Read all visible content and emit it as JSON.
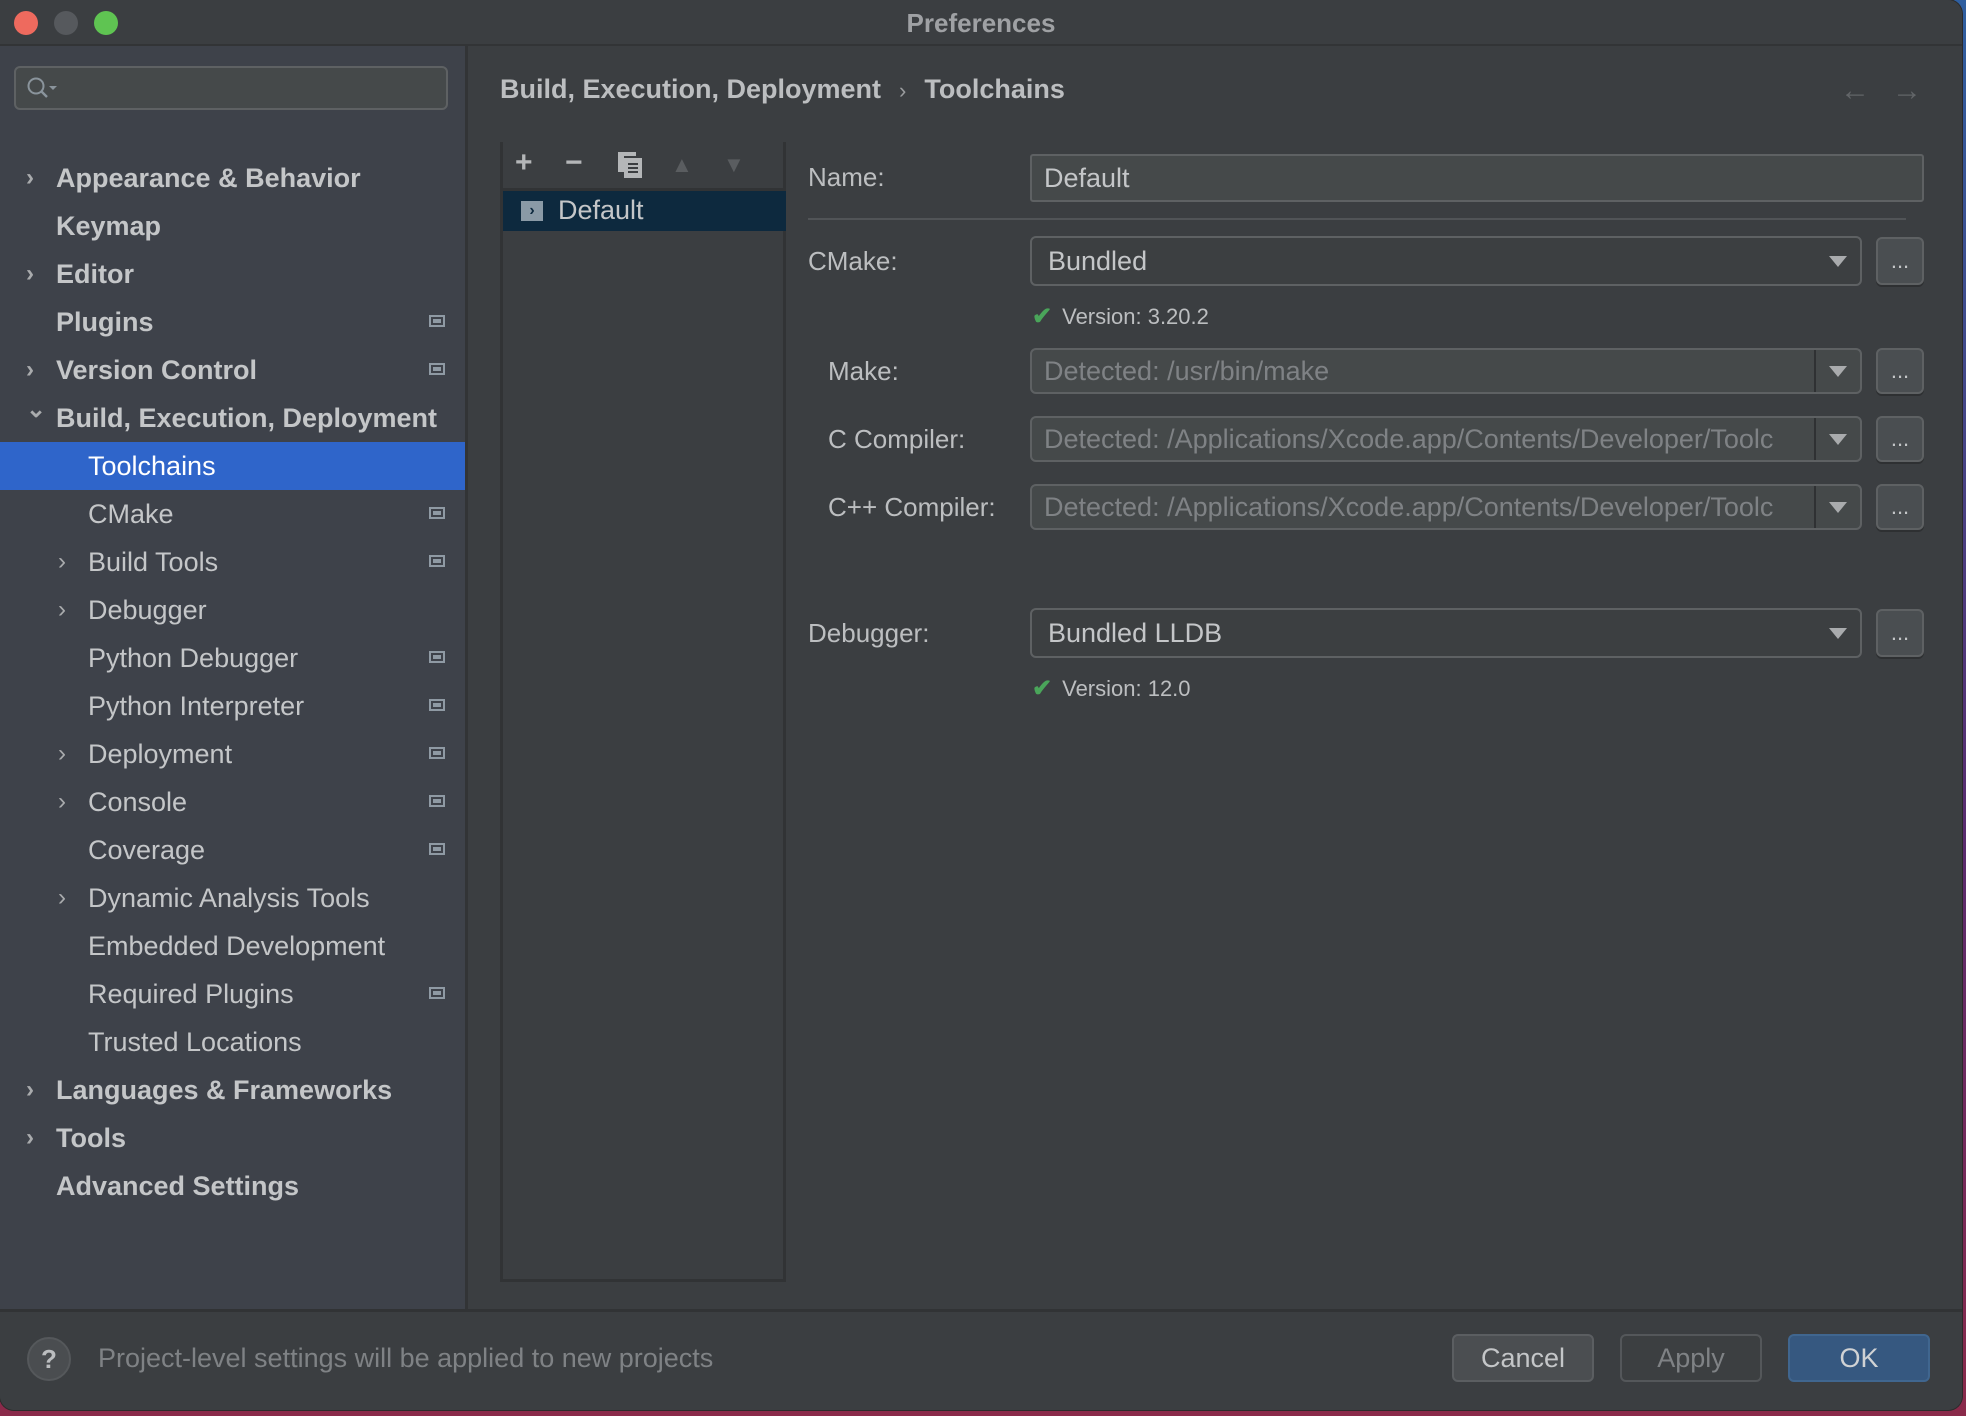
{
  "window": {
    "title": "Preferences",
    "controls": [
      "close",
      "minimize",
      "zoom"
    ]
  },
  "sidebar": {
    "search": {
      "value": "",
      "placeholder": ""
    },
    "items": [
      {
        "label": "Appearance & Behavior",
        "level": 0,
        "expandable": true,
        "expanded": false,
        "bold": true,
        "project_icon": false
      },
      {
        "label": "Keymap",
        "level": 0,
        "expandable": false,
        "bold": true,
        "project_icon": false
      },
      {
        "label": "Editor",
        "level": 0,
        "expandable": true,
        "expanded": false,
        "bold": true,
        "project_icon": false
      },
      {
        "label": "Plugins",
        "level": 0,
        "expandable": false,
        "bold": true,
        "project_icon": true
      },
      {
        "label": "Version Control",
        "level": 0,
        "expandable": true,
        "expanded": false,
        "bold": true,
        "project_icon": true
      },
      {
        "label": "Build, Execution, Deployment",
        "level": 0,
        "expandable": true,
        "expanded": true,
        "bold": true,
        "project_icon": false
      },
      {
        "label": "Toolchains",
        "level": 1,
        "expandable": false,
        "selected": true,
        "project_icon": false
      },
      {
        "label": "CMake",
        "level": 1,
        "expandable": false,
        "project_icon": true
      },
      {
        "label": "Build Tools",
        "level": 1,
        "expandable": true,
        "expanded": false,
        "project_icon": true
      },
      {
        "label": "Debugger",
        "level": 1,
        "expandable": true,
        "expanded": false,
        "project_icon": false
      },
      {
        "label": "Python Debugger",
        "level": 1,
        "expandable": false,
        "project_icon": true
      },
      {
        "label": "Python Interpreter",
        "level": 1,
        "expandable": false,
        "project_icon": true
      },
      {
        "label": "Deployment",
        "level": 1,
        "expandable": true,
        "expanded": false,
        "project_icon": true
      },
      {
        "label": "Console",
        "level": 1,
        "expandable": true,
        "expanded": false,
        "project_icon": true
      },
      {
        "label": "Coverage",
        "level": 1,
        "expandable": false,
        "project_icon": true
      },
      {
        "label": "Dynamic Analysis Tools",
        "level": 1,
        "expandable": true,
        "expanded": false,
        "project_icon": false
      },
      {
        "label": "Embedded Development",
        "level": 1,
        "expandable": false,
        "project_icon": false
      },
      {
        "label": "Required Plugins",
        "level": 1,
        "expandable": false,
        "project_icon": true
      },
      {
        "label": "Trusted Locations",
        "level": 1,
        "expandable": false,
        "project_icon": false
      },
      {
        "label": "Languages & Frameworks",
        "level": 0,
        "expandable": true,
        "expanded": false,
        "bold": true,
        "project_icon": false
      },
      {
        "label": "Tools",
        "level": 0,
        "expandable": true,
        "expanded": false,
        "bold": true,
        "project_icon": false
      },
      {
        "label": "Advanced Settings",
        "level": 0,
        "expandable": false,
        "bold": true,
        "project_icon": false
      }
    ]
  },
  "header": {
    "breadcrumb": [
      "Build, Execution, Deployment",
      "Toolchains"
    ],
    "separator": "›",
    "back_icon": "←",
    "forward_icon": "→"
  },
  "toolchains": {
    "toolbar": {
      "add": "+",
      "remove": "−",
      "copy": "copy-icon",
      "move_up": "▲",
      "move_down": "▼"
    },
    "list": [
      {
        "label": "Default",
        "selected": true
      }
    ]
  },
  "form": {
    "name": {
      "label": "Name:",
      "value": "Default"
    },
    "cmake": {
      "label": "CMake:",
      "value": "Bundled",
      "version": "Version: 3.20.2",
      "browse": "..."
    },
    "make": {
      "label": "Make:",
      "value": "Detected: /usr/bin/make",
      "browse": "..."
    },
    "c_compiler": {
      "label": "C Compiler:",
      "value": "Detected: /Applications/Xcode.app/Contents/Developer/Toolc",
      "browse": "..."
    },
    "cpp_compiler": {
      "label": "C++ Compiler:",
      "value": "Detected: /Applications/Xcode.app/Contents/Developer/Toolc",
      "browse": "..."
    },
    "debugger": {
      "label": "Debugger:",
      "value": "Bundled LLDB",
      "version": "Version: 12.0",
      "browse": "..."
    }
  },
  "footer": {
    "help": "?",
    "hint": "Project-level settings will be applied to new projects",
    "cancel": "Cancel",
    "apply": "Apply",
    "ok": "OK"
  },
  "colors": {
    "selection": "#2f65ca",
    "list_selection": "#0d293e",
    "ok_button": "#365880",
    "check": "#4aa55a"
  }
}
